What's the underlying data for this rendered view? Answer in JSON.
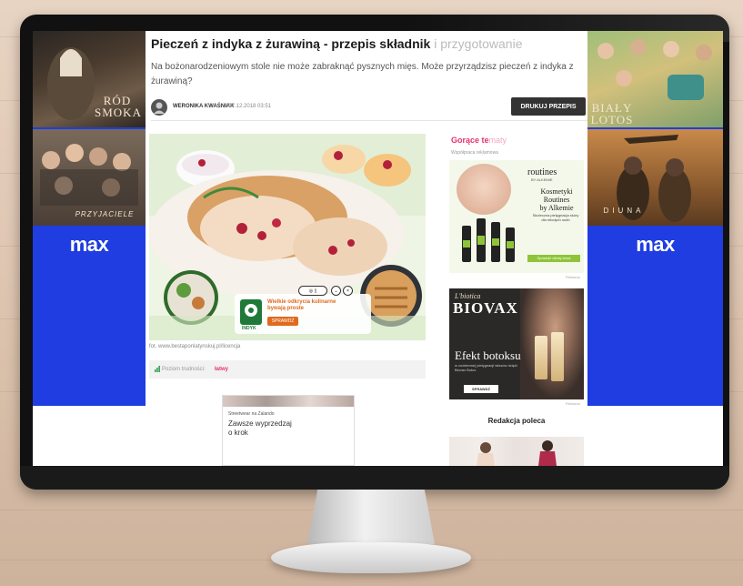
{
  "article": {
    "headline_main": "Pieczeń z indyka z żurawiną - przepis składnik",
    "headline_faded": "i przygotowanie",
    "lead": "Na bożonarodzeniowym stole nie może zabraknąć pysznych mięs. Może przyrządzisz pieczeń z indyka z żurawiną?",
    "author": "WERONIKA KWAŚNIAK",
    "date": "/ 07.12.2018 03:51",
    "print_label": "DRUKUJ PRZEPIS",
    "image_credit": "fot. www.bestaponlatynskuj.pl/licencja",
    "rating_label": "Poziom trudności:",
    "rating_value": "łatwy"
  },
  "hero_ad": {
    "brand": "INDYK",
    "text_line1": "Wielkie odkrycia kulinarne",
    "text_line2": "bywają proste",
    "button": "SPRAWDŹ"
  },
  "inline_ad": {
    "source": "Streetwear na Zalando",
    "text_line1": "Zawsze wyprzedzaj",
    "text_line2": "o krok"
  },
  "left_side": {
    "poster1_title_line1": "RÓD",
    "poster1_title_line2": "SMOKA",
    "poster2_title": "PRZYJACIELE",
    "logo": "max"
  },
  "right_side": {
    "poster1_title_line1": "BIAŁY",
    "poster1_title_line2": "LOTOS",
    "poster2_title": "DIUNA",
    "logo": "max"
  },
  "sidebar": {
    "title_main": "Gorące te",
    "title_faded": "maty",
    "sub": "Współpraca reklamowa",
    "ad1": {
      "brand": "routines",
      "brand_sub": "BY ALKEMIE",
      "head_line1": "Kosmetyki",
      "head_line2": "Routines",
      "head_line3": "by Alkemie",
      "body": "Skuteczna pielęgnacja skóry dla młodych osób",
      "cta": "Sprawdź ofertę teraz",
      "tag": "Reklama"
    },
    "ad2": {
      "brand_small": "L'biotica",
      "brand": "BIOVAX",
      "head": "Efekt botoksu",
      "body": "w codziennej pielęgnacji włosów dzięki Biovax Botox",
      "cta": "SPRAWDŹ",
      "tag": "Reklama"
    },
    "recommend_title": "Redakcja poleca"
  },
  "colors": {
    "hbo_blue": "#1f3de0",
    "accent_pink": "#e5326e",
    "print_button": "#333333"
  }
}
